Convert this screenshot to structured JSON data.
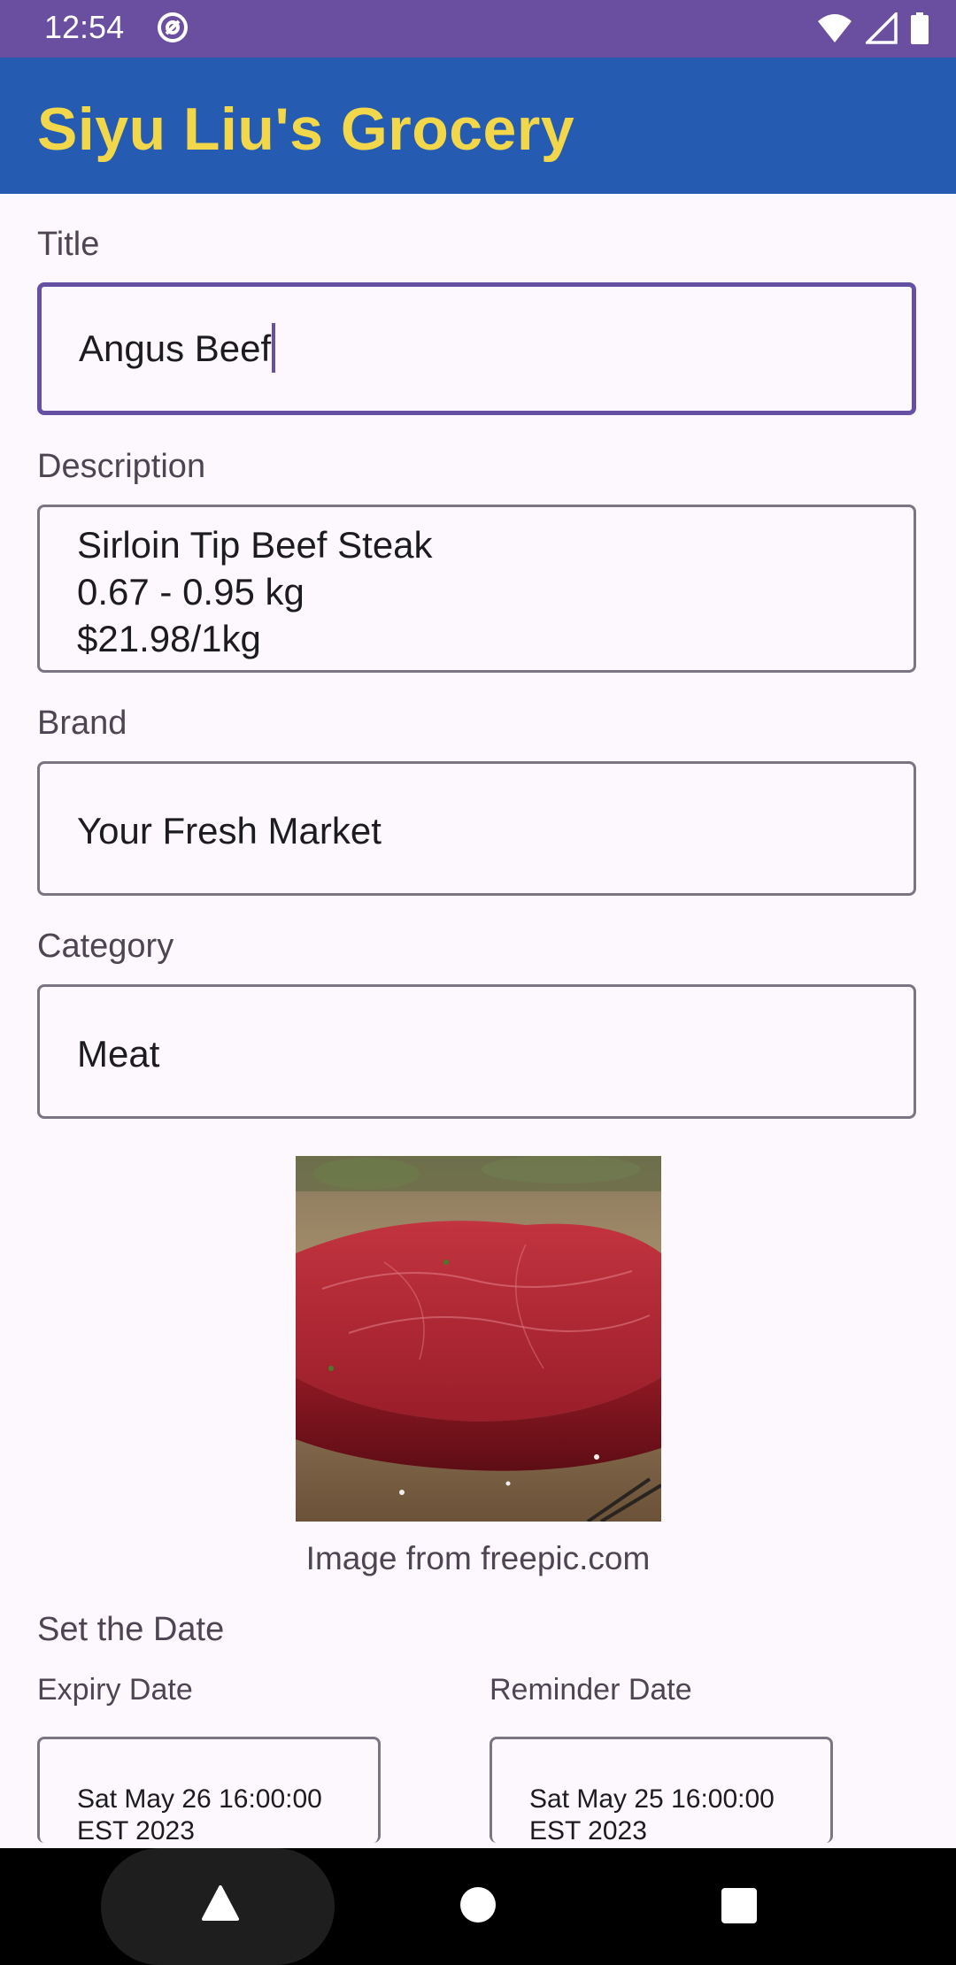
{
  "status_bar": {
    "time": "12:54"
  },
  "app_bar": {
    "title": "Siyu Liu's Grocery"
  },
  "form": {
    "title_label": "Title",
    "title_value": "Angus Beef",
    "description_label": "Description",
    "description_lines": [
      "Sirloin Tip Beef Steak",
      "0.67 - 0.95 kg",
      "$21.98/1kg"
    ],
    "brand_label": "Brand",
    "brand_value": "Your Fresh Market",
    "category_label": "Category",
    "category_value": "Meat"
  },
  "image": {
    "caption": "Image from freepic.com"
  },
  "dates": {
    "section_title": "Set the Date",
    "expiry_label": "Expiry Date",
    "expiry_value_line1": "Sat May 26 16:00:00",
    "expiry_value_line2": "EST 2023",
    "reminder_label": "Reminder Date",
    "reminder_value_line1": "Sat May 25 16:00:00",
    "reminder_value_line2": "EST 2023"
  },
  "icons": {
    "status": [
      "at-sign-icon",
      "wifi-icon",
      "signal-icon",
      "battery-icon"
    ],
    "nav": [
      "back-triangle-icon",
      "home-circle-icon",
      "recents-square-icon"
    ]
  },
  "colors": {
    "status_bar": "#6a4fa0",
    "app_bar": "#255cb2",
    "app_title": "#f2d74a",
    "focus_outline": "#6650a4"
  }
}
